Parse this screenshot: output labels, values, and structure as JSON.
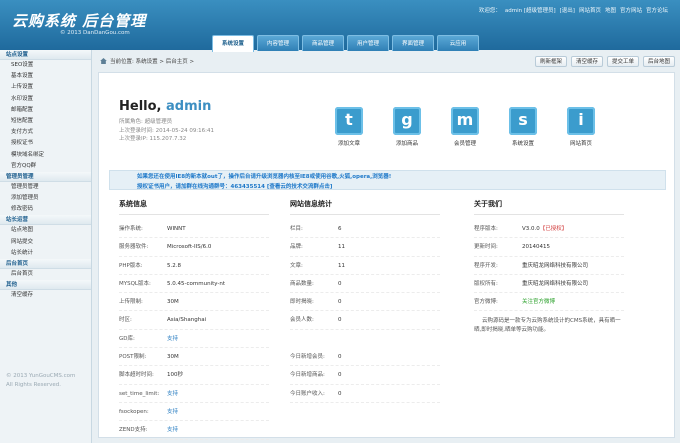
{
  "header": {
    "logo_title": "云购系统 后台管理",
    "logo_sub": "© 2013 DanDanGou.com",
    "toplinks": [
      "欢迎您：",
      "admin [超级管理员]",
      "[退出]",
      "网站首页",
      "地图",
      "官方网站",
      "官方论坛"
    ],
    "tabs": [
      "系统设置",
      "内容管理",
      "商品管理",
      "用户管理",
      "界面管理",
      "云应用"
    ],
    "active_tab": 0
  },
  "sidebar": {
    "groups": [
      {
        "title": "站点设置",
        "items": [
          "SEO设置",
          "基本设置",
          "上传设置",
          "水印设置",
          "邮箱配置",
          "短信配置",
          "支付方式",
          "授权证书",
          "模块域名绑定",
          "官方QQ群"
        ]
      },
      {
        "title": "管理员管理",
        "items": [
          "管理员管理",
          "添加管理员",
          "修改密码"
        ]
      },
      {
        "title": "站长运营",
        "items": [
          "站点地图",
          "网站提交",
          "站长统计"
        ]
      },
      {
        "title": "后台首页",
        "items": [
          "后台首页"
        ]
      },
      {
        "title": "其他",
        "items": [
          "清空缓存"
        ]
      }
    ],
    "copyright": [
      "© 2013 YunGouCMS.com",
      "All Rights Reserved."
    ]
  },
  "breadcrumb": {
    "text": "当前位置: 系统设置 > 后台主页 >",
    "buttons": [
      "刷新框架",
      "清空缓存",
      "提交工单",
      "后台地图"
    ]
  },
  "welcome": {
    "hello": "Hello,",
    "username": "admin",
    "info": [
      "所属角色: 超级管理员",
      "上次登录时间: 2014-05-24 09:16:41",
      "上次登录IP: 115.207.7.32"
    ]
  },
  "quick_links": [
    {
      "letter": "t",
      "label": "添加文章"
    },
    {
      "letter": "g",
      "label": "添加商品"
    },
    {
      "letter": "m",
      "label": "会员管理"
    },
    {
      "letter": "s",
      "label": "系统设置"
    },
    {
      "letter": "i",
      "label": "网站首页"
    }
  ],
  "notice": [
    "如果您还在使用IE8的新本就out了，操作后台请升级浏览器内核至IE8或使用谷歌,火狐,opera,浏览器!",
    "授权证书用户，请加群在线沟通群号：463435514 [查看云的技术交流群点击]"
  ],
  "system_info": {
    "title": "系统信息",
    "rows": [
      {
        "k": "操作系统:",
        "v": "WINNT"
      },
      {
        "k": "服务器软件:",
        "v": "Microsoft-IIS/6.0"
      },
      {
        "k": "PHP版本:",
        "v": "5.2.8"
      },
      {
        "k": "MYSQL版本:",
        "v": "5.0.45-community-nt"
      },
      {
        "k": "上传限制:",
        "v": "30M"
      },
      {
        "k": "时区:",
        "v": "Asia/Shanghai"
      },
      {
        "k": "GD库:",
        "v": "支持"
      },
      {
        "k": "POST限制:",
        "v": "30M"
      },
      {
        "k": "脚本超时时间:",
        "v": "100秒"
      },
      {
        "k": "set_time_limit:",
        "v": "支持"
      },
      {
        "k": "fsockopen:",
        "v": "支持"
      },
      {
        "k": "ZEND支持:",
        "v": "支持"
      }
    ]
  },
  "site_stats": {
    "title": "网站信息统计",
    "rows": [
      {
        "k": "栏目:",
        "v": "6"
      },
      {
        "k": "品牌:",
        "v": "11"
      },
      {
        "k": "文章:",
        "v": "11"
      },
      {
        "k": "商品数量:",
        "v": "0"
      },
      {
        "k": "即时揭晓:",
        "v": "0"
      },
      {
        "k": "会员人数:",
        "v": "0"
      },
      {
        "k": "",
        "v": ""
      },
      {
        "k": "今日新增会员:",
        "v": "0"
      },
      {
        "k": "今日新增商品:",
        "v": "0"
      },
      {
        "k": "今日账户收入:",
        "v": "0"
      }
    ]
  },
  "about": {
    "title": "关于我们",
    "rows": [
      {
        "k": "程序版本:",
        "v": "V3.0.0",
        "badge": "【已授权】"
      },
      {
        "k": "更新时间:",
        "v": "20140415"
      },
      {
        "k": "程序开发:",
        "v": "重庆昭龙网络科技有限公司"
      },
      {
        "k": "版权所有:",
        "v": "重庆昭龙网络科技有限公司"
      },
      {
        "k": "官方微博:",
        "v": "关注官方微博"
      }
    ],
    "desc": "云购源码是一款专为云购系统设计的CMS系统，具有晒一晒,即时揭晓,晒单等云购功能。"
  },
  "colors": {
    "header": "#2a7cb0",
    "link": "#2a7ec2",
    "notice": "#1d78c9",
    "badge": "#d23b3b"
  }
}
